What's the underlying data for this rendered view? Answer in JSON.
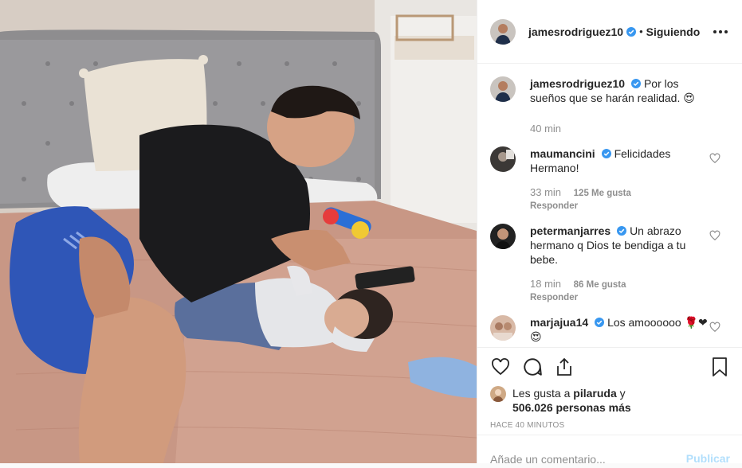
{
  "header": {
    "username": "jamesrodriguez10",
    "separator": "•",
    "follow_status": "Siguiendo"
  },
  "caption": {
    "username": "jamesrodriguez10",
    "text": "Por los sueños que se harán realidad. 😍",
    "time": "40 min"
  },
  "comments": [
    {
      "username": "maumancini",
      "verified": true,
      "text": "Felicidades Hermano!",
      "time": "33 min",
      "likes": "125 Me gusta",
      "reply": "Responder"
    },
    {
      "username": "petermanjarres",
      "verified": true,
      "text": "Un abrazo hermano q Dios te bendiga a tu bebe.",
      "time": "18 min",
      "likes": "86 Me gusta",
      "reply": "Responder"
    },
    {
      "username": "marjajua14",
      "verified": true,
      "text": "Los amoooooo 🌹❤😍",
      "time": "",
      "likes": "",
      "reply": ""
    }
  ],
  "likes_line": {
    "prefix": "Les gusta a",
    "user": "pilaruda",
    "conj": "y",
    "count": "506.026 personas más"
  },
  "time_ago": "HACE 40 MINUTOS",
  "add_comment": {
    "placeholder": "Añade un comentario...",
    "publish": "Publicar"
  },
  "icons": {
    "like": "heart-outline-icon",
    "comment": "comment-bubble-icon",
    "share": "share-icon",
    "save": "bookmark-icon",
    "more": "more-options-icon",
    "verified": "verified-badge-icon"
  },
  "colors": {
    "verified": "#3897f0",
    "publish_disabled": "#b2dffc",
    "muted": "#8e8e8e",
    "text": "#262626"
  }
}
